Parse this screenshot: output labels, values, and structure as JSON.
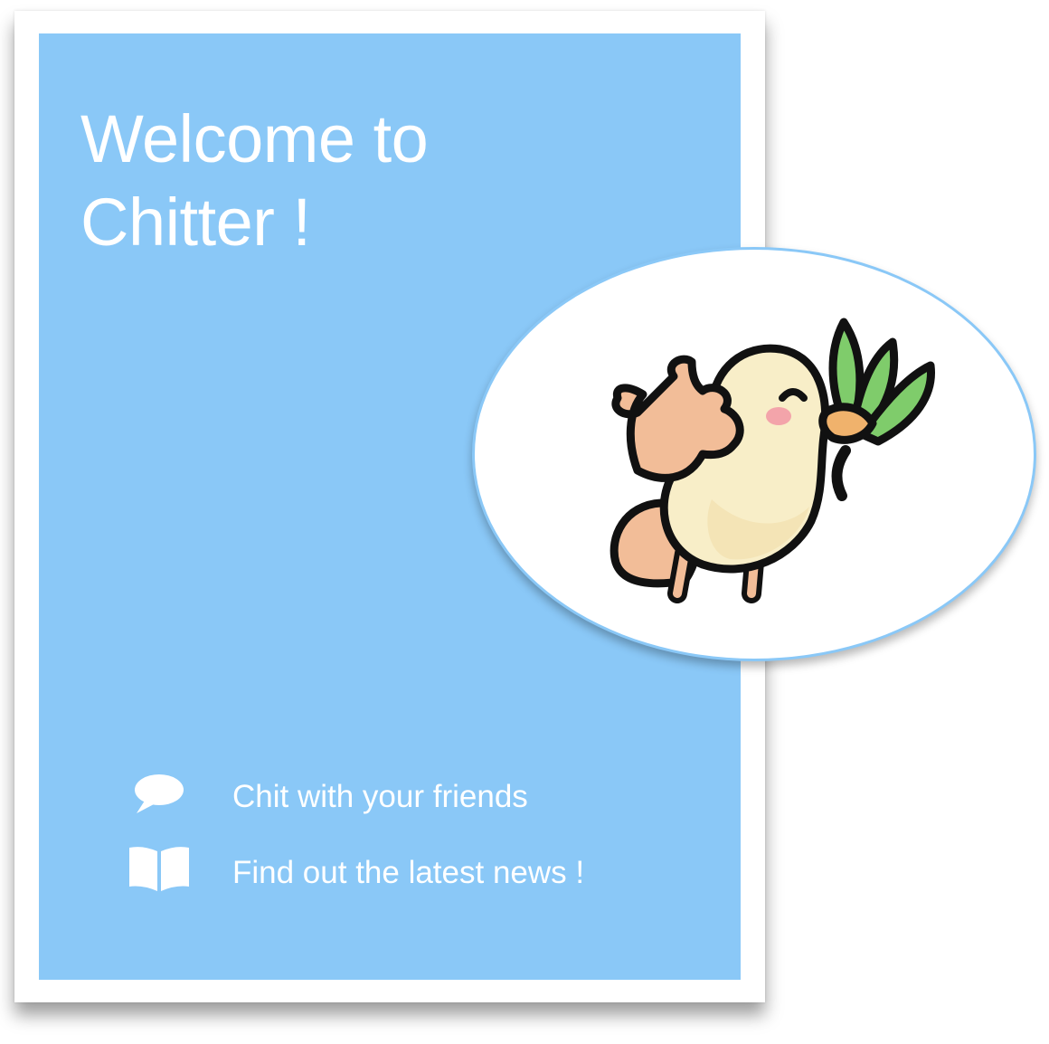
{
  "header": {
    "title_line1": "Welcome to",
    "title_line2": "Chitter !"
  },
  "features": [
    {
      "icon": "speech-bubble-icon",
      "label": "Chit with your friends"
    },
    {
      "icon": "open-book-icon",
      "label": "Find out the latest news !"
    }
  ],
  "logo": {
    "icon": "bird-with-leaves-icon"
  },
  "colors": {
    "panel": "#8ac8f7",
    "text": "#ffffff",
    "bird_body": "#f8eec8",
    "bird_wing": "#f2bd98",
    "leaves": "#7fcc6b",
    "beak": "#f0b26c",
    "cheek": "#f3a4aa"
  }
}
